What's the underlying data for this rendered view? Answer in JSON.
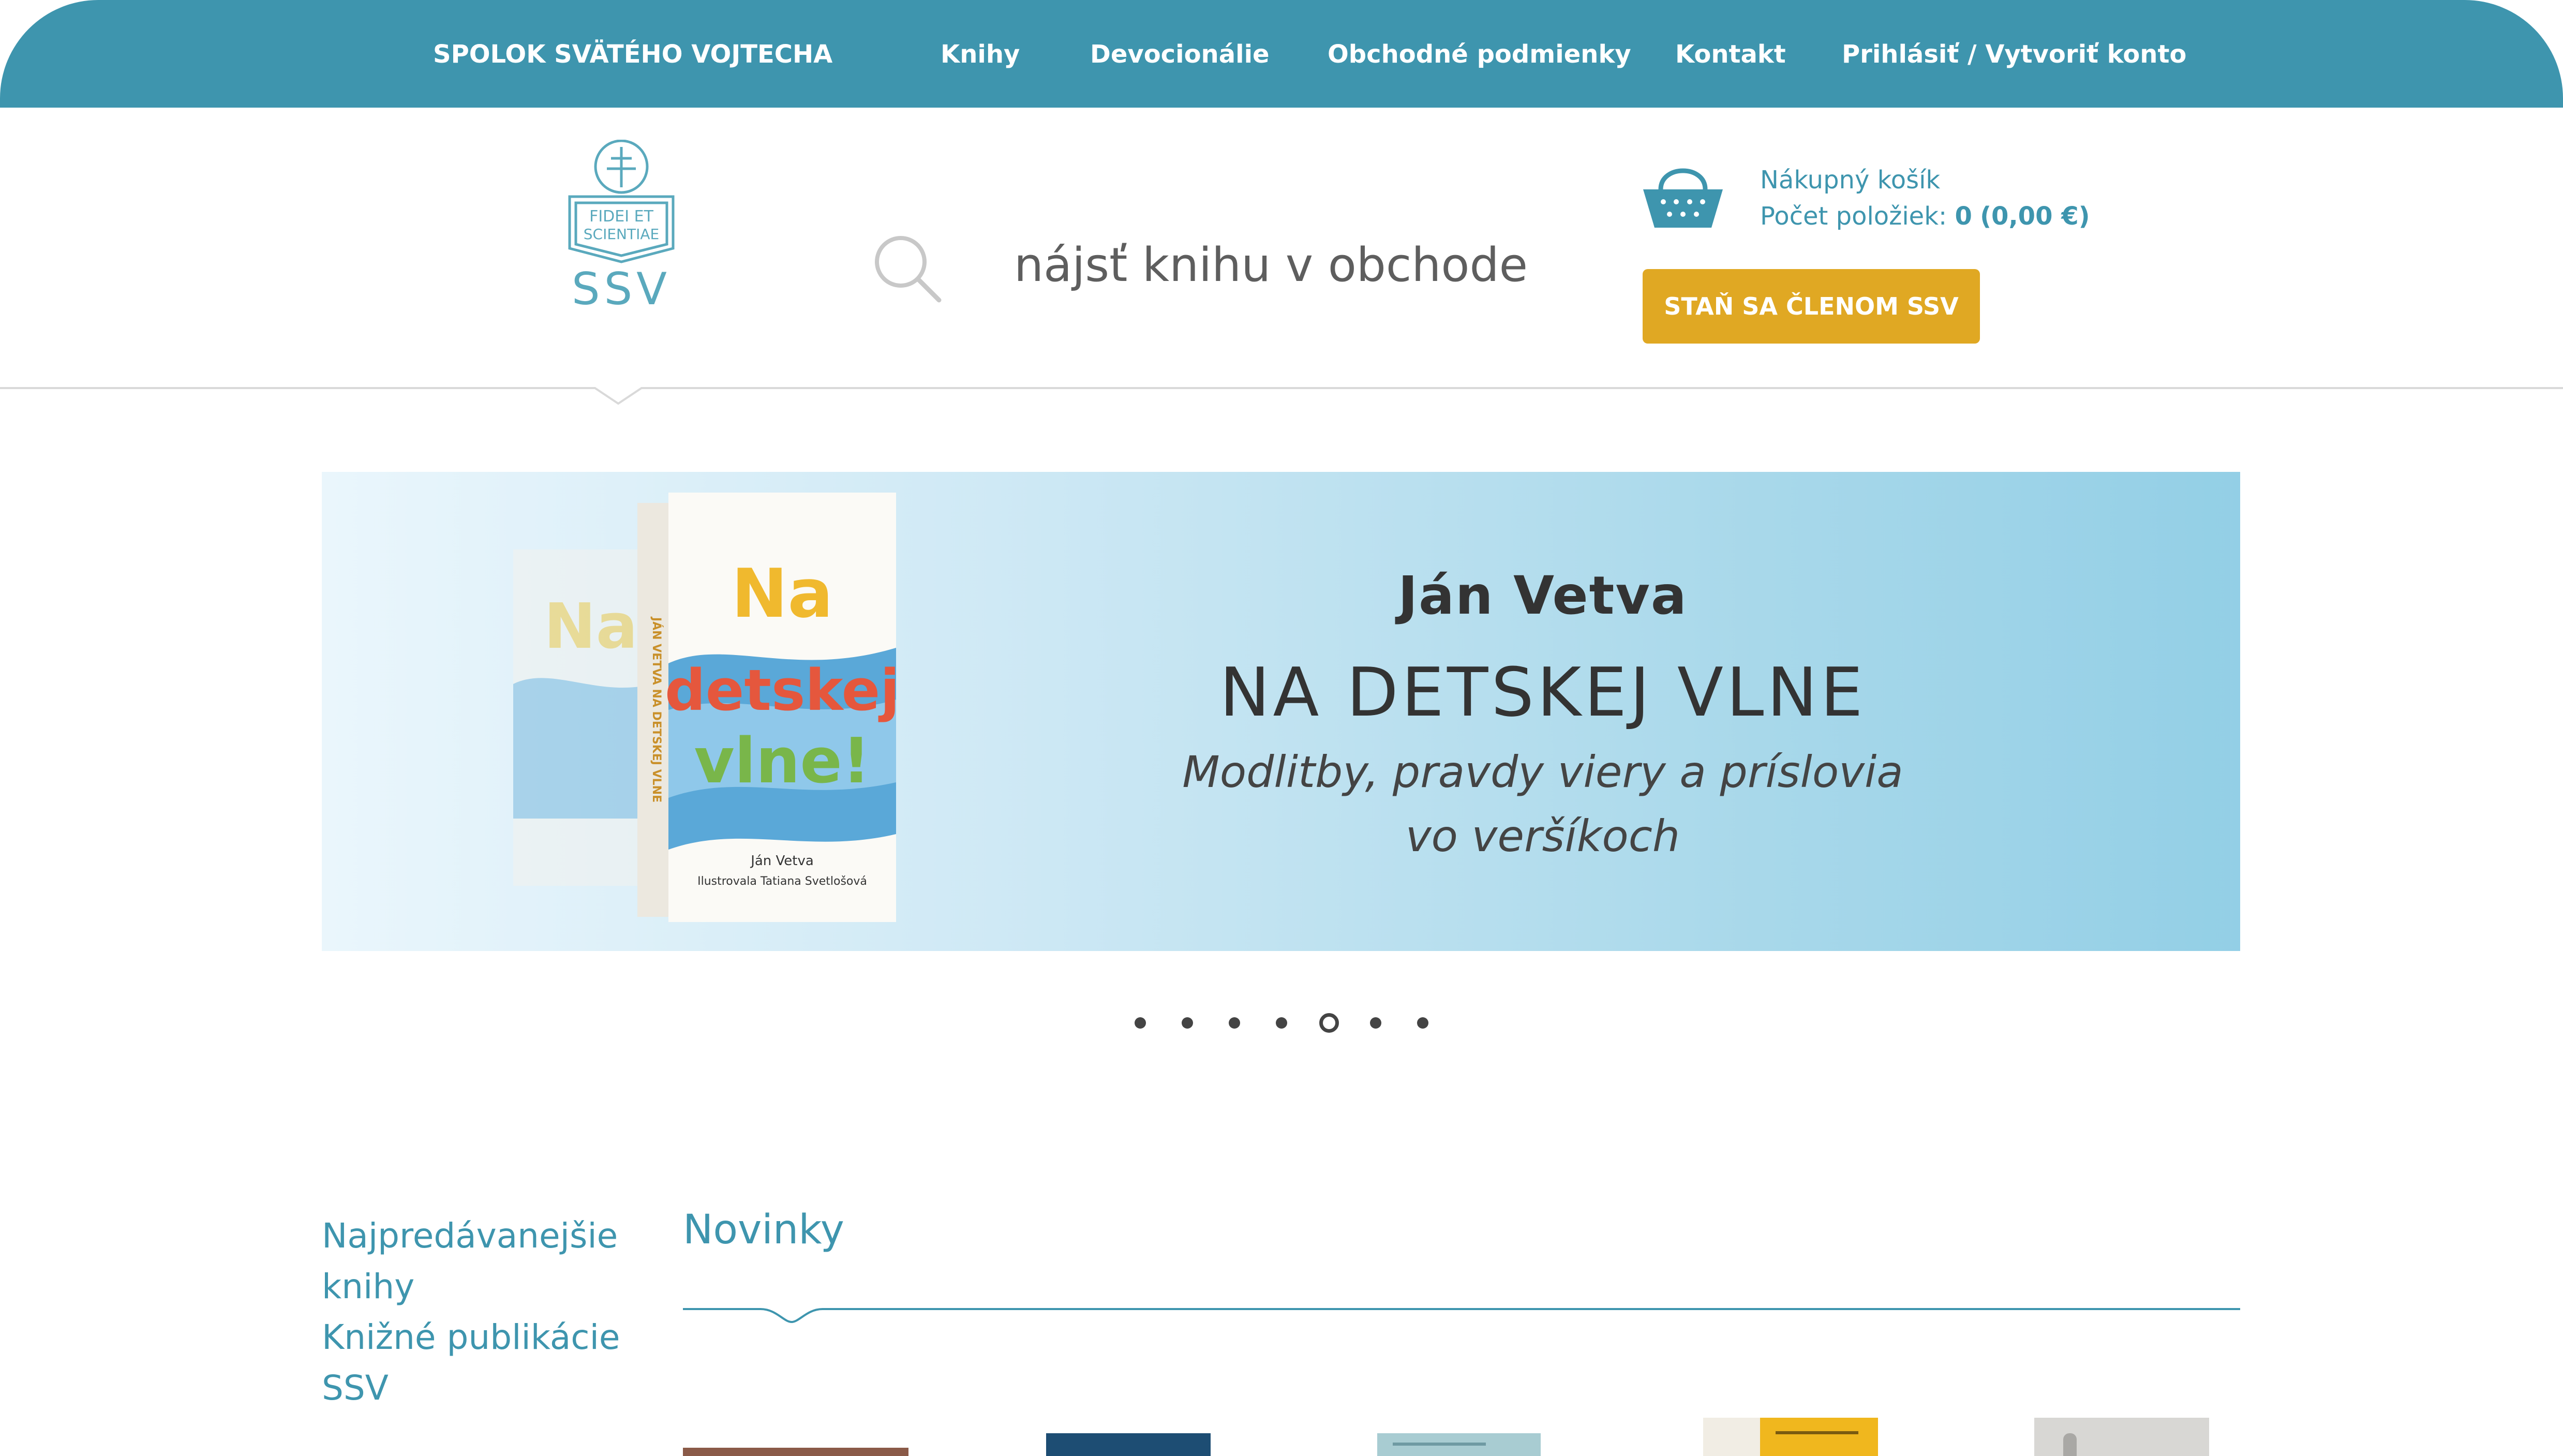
{
  "nav": {
    "brand": "SPOLOK SVÄTÉHO VOJTECHA",
    "items": [
      {
        "label": "Knihy"
      },
      {
        "label": "Devocionálie"
      },
      {
        "label": "Obchodné podmienky"
      },
      {
        "label": "Kontakt"
      },
      {
        "label": "Prihlásiť / Vytvoriť konto"
      }
    ]
  },
  "logo": {
    "motto_line1": "FIDEI ET",
    "motto_line2": "SCIENTIAE",
    "letters": "SSV",
    "icon": "cross-logo-icon"
  },
  "search": {
    "placeholder": "nájsť knihu v obchode",
    "icon": "search-icon"
  },
  "cart": {
    "title": "Nákupný košík",
    "count_label": "Počet položiek:",
    "count": "0",
    "total": "(0,00 €)",
    "icon": "basket-icon"
  },
  "member_button": "STAŇ SA ČLENOM SSV",
  "banner": {
    "author": "Ján Vetva",
    "title": "NA DETSKEJ VLNE",
    "subtitle_line1": "Modlitby, pravdy viery a príslovia",
    "subtitle_line2": "vo veršíkoch",
    "book_cover_title": "Na detskej vlne!",
    "book_spine": "JÁN VETVA  NA DETSKEJ VLNE",
    "book_author": "Ján Vetva",
    "book_illustrator": "Ilustrovala Tatiana Svetlošová"
  },
  "slider": {
    "count": 7,
    "active_index": 4
  },
  "sidebar": {
    "links": [
      {
        "line1": "Najpredávanejšie",
        "line2": "knihy"
      },
      {
        "line1": "Knižné publikácie",
        "line2": "SSV"
      }
    ]
  },
  "section": {
    "title": "Novinky"
  },
  "colors": {
    "primary": "#3e95ae",
    "accent": "#e0a823",
    "text": "#333333"
  }
}
